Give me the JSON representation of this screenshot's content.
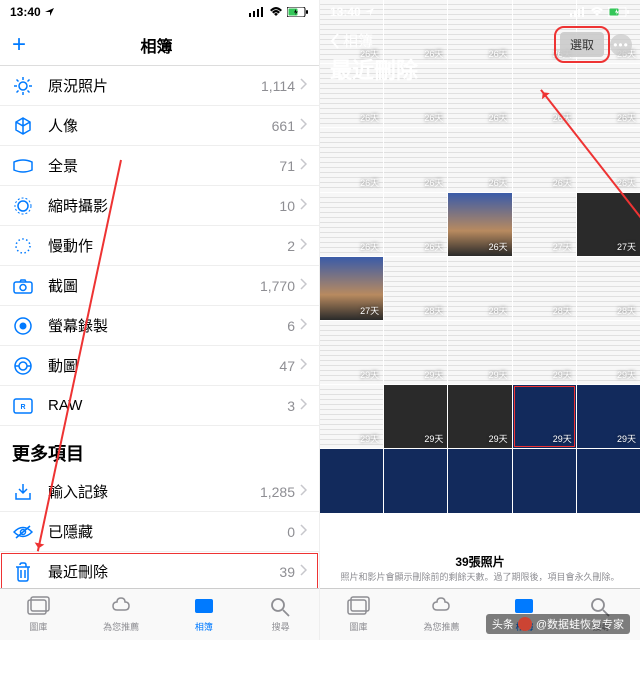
{
  "statusbar": {
    "time": "13:40"
  },
  "left": {
    "nav_title": "相簿",
    "items": [
      {
        "icon": "spark",
        "label": "原況照片",
        "count": "1,114"
      },
      {
        "icon": "cube",
        "label": "人像",
        "count": "661"
      },
      {
        "icon": "pano",
        "label": "全景",
        "count": "71"
      },
      {
        "icon": "timelapse",
        "label": "縮時攝影",
        "count": "10"
      },
      {
        "icon": "slowmo",
        "label": "慢動作",
        "count": "2"
      },
      {
        "icon": "camera",
        "label": "截圖",
        "count": "1,770"
      },
      {
        "icon": "record",
        "label": "螢幕錄製",
        "count": "6"
      },
      {
        "icon": "gif",
        "label": "動圖",
        "count": "47"
      },
      {
        "icon": "raw",
        "label": "RAW",
        "count": "3"
      }
    ],
    "section_more": "更多項目",
    "more_items": [
      {
        "icon": "import",
        "label": "輸入記錄",
        "count": "1,285"
      },
      {
        "icon": "hidden",
        "label": "已隱藏",
        "count": "0"
      },
      {
        "icon": "trash",
        "label": "最近刪除",
        "count": "39"
      }
    ],
    "tabs": [
      {
        "label": "圖庫"
      },
      {
        "label": "為您推薦"
      },
      {
        "label": "相簿"
      },
      {
        "label": "搜尋"
      }
    ]
  },
  "right": {
    "back_label": "相簿",
    "title": "最近刪除",
    "select_label": "選取",
    "cells": [
      {
        "d": "26天",
        "c": "doc"
      },
      {
        "d": "26天",
        "c": "doc"
      },
      {
        "d": "26天",
        "c": "doc"
      },
      {
        "d": "26天",
        "c": "doc"
      },
      {
        "d": "26天",
        "c": "doc"
      },
      {
        "d": "26天",
        "c": "doc"
      },
      {
        "d": "26天",
        "c": "doc"
      },
      {
        "d": "26天",
        "c": "doc"
      },
      {
        "d": "26天",
        "c": "doc"
      },
      {
        "d": "26天",
        "c": "doc"
      },
      {
        "d": "26天",
        "c": "doc"
      },
      {
        "d": "26天",
        "c": "doc"
      },
      {
        "d": "26天",
        "c": "doc"
      },
      {
        "d": "26天",
        "c": "doc"
      },
      {
        "d": "26天",
        "c": "doc"
      },
      {
        "d": "26天",
        "c": "doc"
      },
      {
        "d": "26天",
        "c": "doc"
      },
      {
        "d": "26天",
        "c": "sky"
      },
      {
        "d": "27天",
        "c": "doc"
      },
      {
        "d": "27天",
        "c": "dark"
      },
      {
        "d": "27天",
        "c": "sky"
      },
      {
        "d": "28天",
        "c": "doc"
      },
      {
        "d": "28天",
        "c": "doc"
      },
      {
        "d": "28天",
        "c": "doc"
      },
      {
        "d": "28天",
        "c": "doc"
      },
      {
        "d": "29天",
        "c": "doc"
      },
      {
        "d": "29天",
        "c": "doc"
      },
      {
        "d": "29天",
        "c": "doc"
      },
      {
        "d": "29天",
        "c": "doc"
      },
      {
        "d": "29天",
        "c": "doc"
      },
      {
        "d": "29天",
        "c": "doc"
      },
      {
        "d": "29天",
        "c": "dark"
      },
      {
        "d": "29天",
        "c": "dark"
      },
      {
        "d": "29天",
        "c": "blue",
        "h": true
      },
      {
        "d": "29天",
        "c": "blue"
      },
      {
        "d": "",
        "c": "blue"
      },
      {
        "d": "",
        "c": "blue"
      },
      {
        "d": "",
        "c": "blue"
      },
      {
        "d": "",
        "c": "blue"
      },
      {
        "d": "",
        "c": "blue"
      }
    ],
    "footer_title": "39張照片",
    "footer_sub": "照片和影片會顯示刪除前的剩餘天數。過了期限後，項目會永久刪除。"
  },
  "watermark": {
    "prefix": "头条",
    "at": "@数据蛙恢复专家"
  }
}
